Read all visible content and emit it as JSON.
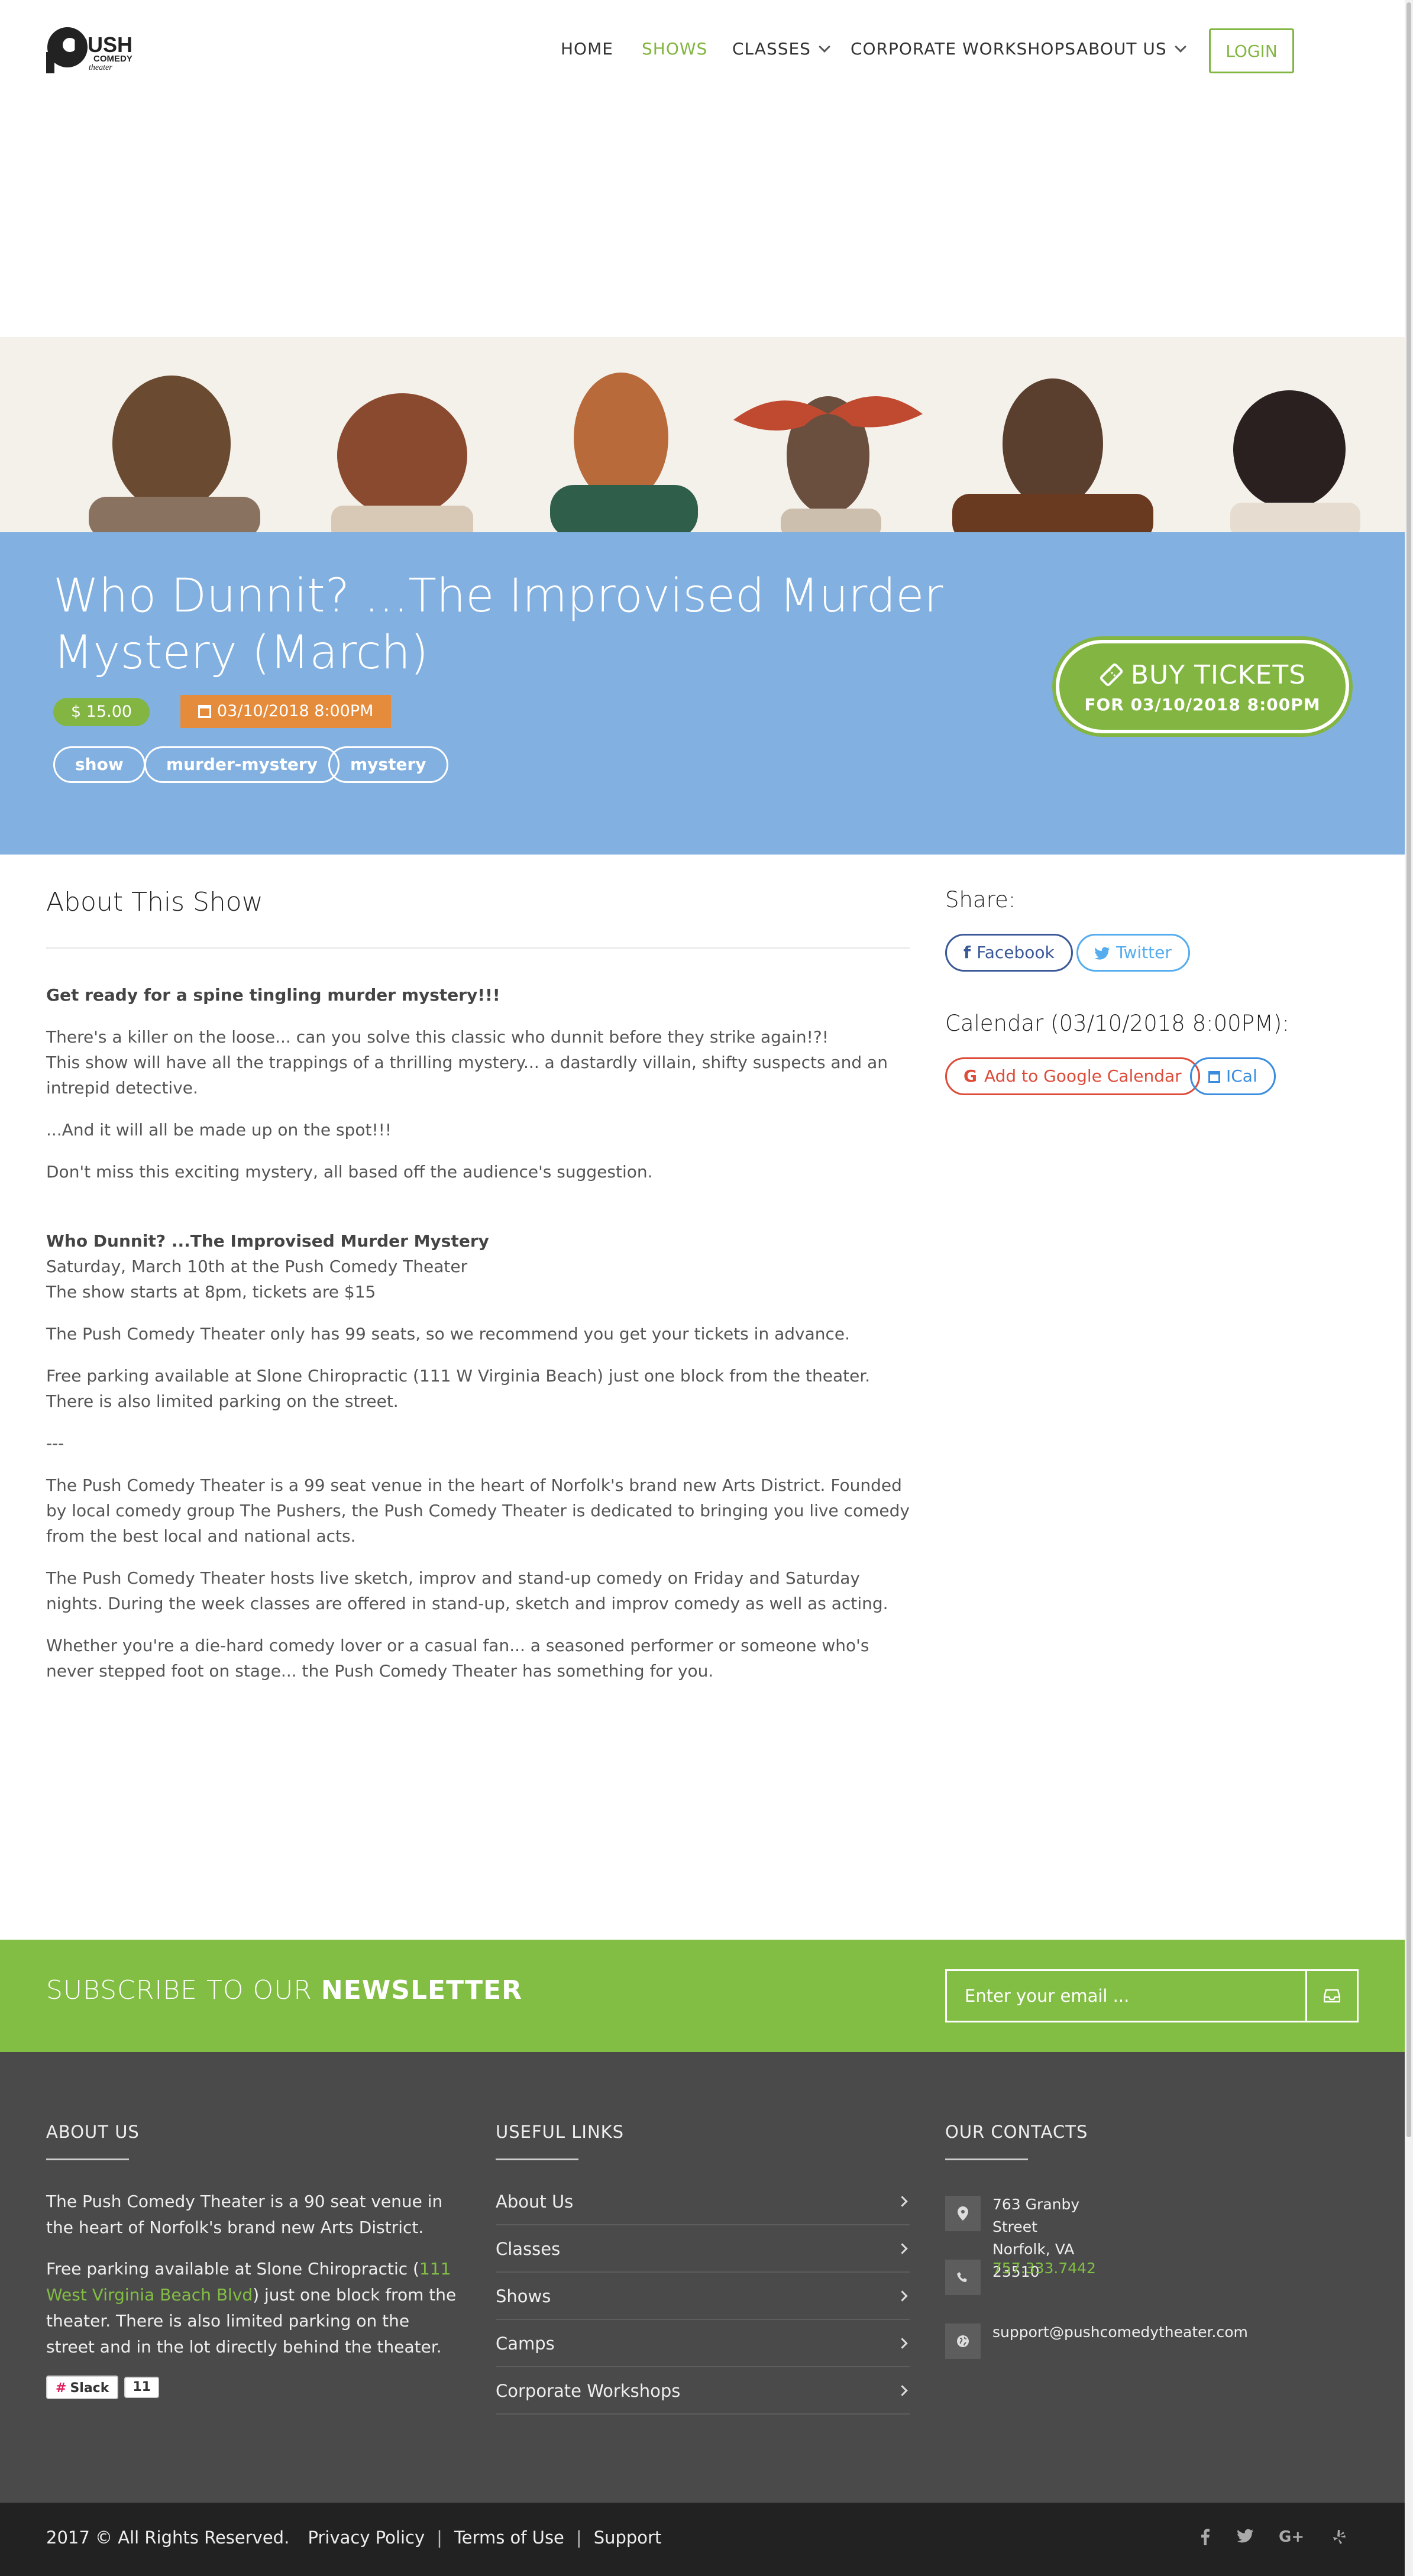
{
  "header": {
    "logo_text_1": "PUSH",
    "logo_text_2": "COMEDY",
    "logo_text_3": "theater",
    "nav": [
      {
        "label": "HOME"
      },
      {
        "label": "SHOWS"
      },
      {
        "label": "CLASSES"
      },
      {
        "label": "CORPORATE WORKSHOPS"
      },
      {
        "label": "ABOUT US"
      }
    ],
    "login_label": "LOGIN"
  },
  "hero": {
    "title": "Who Dunnit? ...The Improvised Murder Mystery (March)",
    "price": "$ 15.00",
    "date": "03/10/2018 8:00PM",
    "tags": [
      "show",
      "murder-mystery",
      "mystery"
    ],
    "buy_label": "BUY TICKETS",
    "buy_sub": "FOR 03/10/2018 8:00PM"
  },
  "about": {
    "title": "About This Show",
    "lead": "Get ready for a spine tingling murder mystery!!!",
    "p1a": "There's a killer on the loose... can you solve this classic who dunnit before they strike again!?!",
    "p1b": "This show will have all the trappings of a thrilling mystery... a dastardly villain, shifty suspects and an intrepid detective.",
    "p2": "...And it will all be made up on the spot!!!",
    "p3": "Don't miss this exciting mystery, all based off the audience's suggestion.",
    "show_name": "Who Dunnit? ...The Improvised Murder Mystery",
    "show_date": "Saturday, March 10th at the Push Comedy Theater",
    "show_time": "The show starts at 8pm, tickets are $15",
    "p4": "The Push Comedy Theater only has 99 seats, so we recommend you get your tickets in advance.",
    "p5": "Free parking available at Slone Chiropractic (111 W Virginia Beach) just one block from the theater. There is also limited parking on the street.",
    "p6": "---",
    "p7": "The Push Comedy Theater is a 99 seat venue in the heart of Norfolk's brand new Arts District. Founded by local comedy group The Pushers, the Push Comedy Theater is dedicated to bringing you live comedy from the best local and national acts.",
    "p8": "The Push Comedy Theater hosts live sketch, improv and stand-up comedy on Friday and Saturday nights. During the week classes are offered in stand-up, sketch and improv comedy as well as acting.",
    "p9": "Whether you're a die-hard comedy lover or a casual fan... a seasoned performer or someone who's never stepped foot on stage... the Push Comedy Theater has something for you."
  },
  "sidebar": {
    "share_title": "Share:",
    "facebook": "Facebook",
    "twitter": "Twitter",
    "calendar_title": "Calendar (03/10/2018 8:00PM):",
    "google_cal": "Add to Google Calendar",
    "ical": "ICal"
  },
  "newsletter": {
    "title_light": "SUBSCRIBE TO OUR",
    "title_bold": "NEWSLETTER",
    "placeholder": "Enter your email ..."
  },
  "footer": {
    "about_title": "ABOUT US",
    "about_p1": "The Push Comedy Theater is a 90 seat venue in the heart of Norfolk's brand new Arts District.",
    "about_p2a": "Free parking available at Slone Chiropractic (",
    "about_p2_link": "111 West Virginia Beach Blvd",
    "about_p2b": ") just one block from the theater. There is also limited parking on the street and in the lot directly behind the theater.",
    "slack_label": "Slack",
    "slack_count": "11",
    "links_title": "USEFUL LINKS",
    "links": [
      "About Us",
      "Classes",
      "Shows",
      "Camps",
      "Corporate Workshops"
    ],
    "contacts_title": "OUR CONTACTS",
    "address_1": "763 Granby Street",
    "address_2": "Norfolk, VA 23510",
    "phone": "757.333.7442",
    "email": "support@pushcomedytheater.com"
  },
  "bottom": {
    "copyright": "2017 © All Rights Reserved.",
    "privacy": "Privacy Policy",
    "terms": "Terms of Use",
    "support": "Support",
    "separator": "|"
  },
  "colors": {
    "accent_green": "#82b541",
    "hero_blue": "#82b0e0",
    "date_orange": "#e58c3c",
    "footer_dark": "#4a4a4a"
  }
}
